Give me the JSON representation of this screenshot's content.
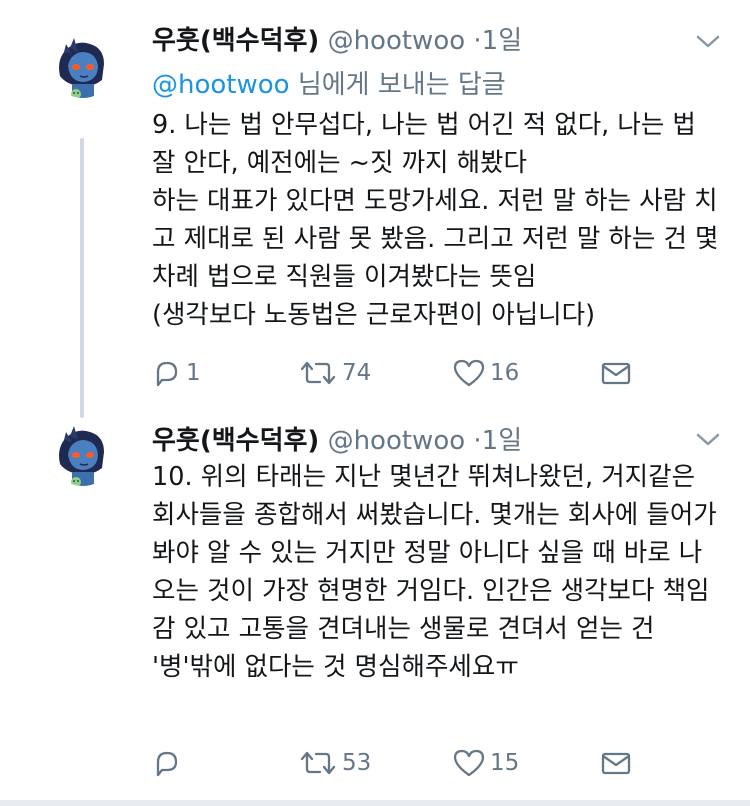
{
  "tweets": [
    {
      "name": "우훗(백수덕후)",
      "handle": "@hootwoo",
      "dot": "·",
      "time": "1일",
      "reply_prefix": "@hootwoo",
      "reply_suffix": " 님에게 보내는 답글",
      "body": "9. 나는 법 안무섭다, 나는 법 어긴 적 없다, 나는 법 잘 안다, 예전에는 ~짓 까지 해봤다\n하는 대표가 있다면 도망가세요. 저런 말 하는 사람 치고 제대로 된 사람 못 봤음. 그리고 저런 말 하는 건 몇 차례 법으로 직원들 이겨봤다는 뜻임\n(생각보다 노동법은 근로자편이 아닙니다)",
      "reply_count": "1",
      "retweet_count": "74",
      "like_count": "16"
    },
    {
      "name": "우훗(백수덕후)",
      "handle": "@hootwoo",
      "dot": "·",
      "time": "1일",
      "body": "10. 위의 타래는 지난 몇년간 뛰쳐나왔던, 거지같은 회사들을 종합해서 써봤습니다. 몇개는 회사에 들어가봐야 알 수 있는 거지만 정말 아니다 싶을 때 바로 나오는 것이 가장 현명한 거임다. 인간은 생각보다 책임감 있고 고통을 견뎌내는 생물로 견뎌서 얻는 건 '병'밖에 없다는 것 명심해주세요ㅠ",
      "reply_count": "",
      "retweet_count": "53",
      "like_count": "15"
    }
  ],
  "icons": {
    "reply": "reply-icon",
    "retweet": "retweet-icon",
    "like": "heart-icon",
    "dm": "envelope-icon",
    "more": "chevron-down-icon"
  },
  "colors": {
    "text": "#14171a",
    "secondary": "#657786",
    "link": "#1b95e0",
    "thread_line": "#d0d9e2"
  }
}
